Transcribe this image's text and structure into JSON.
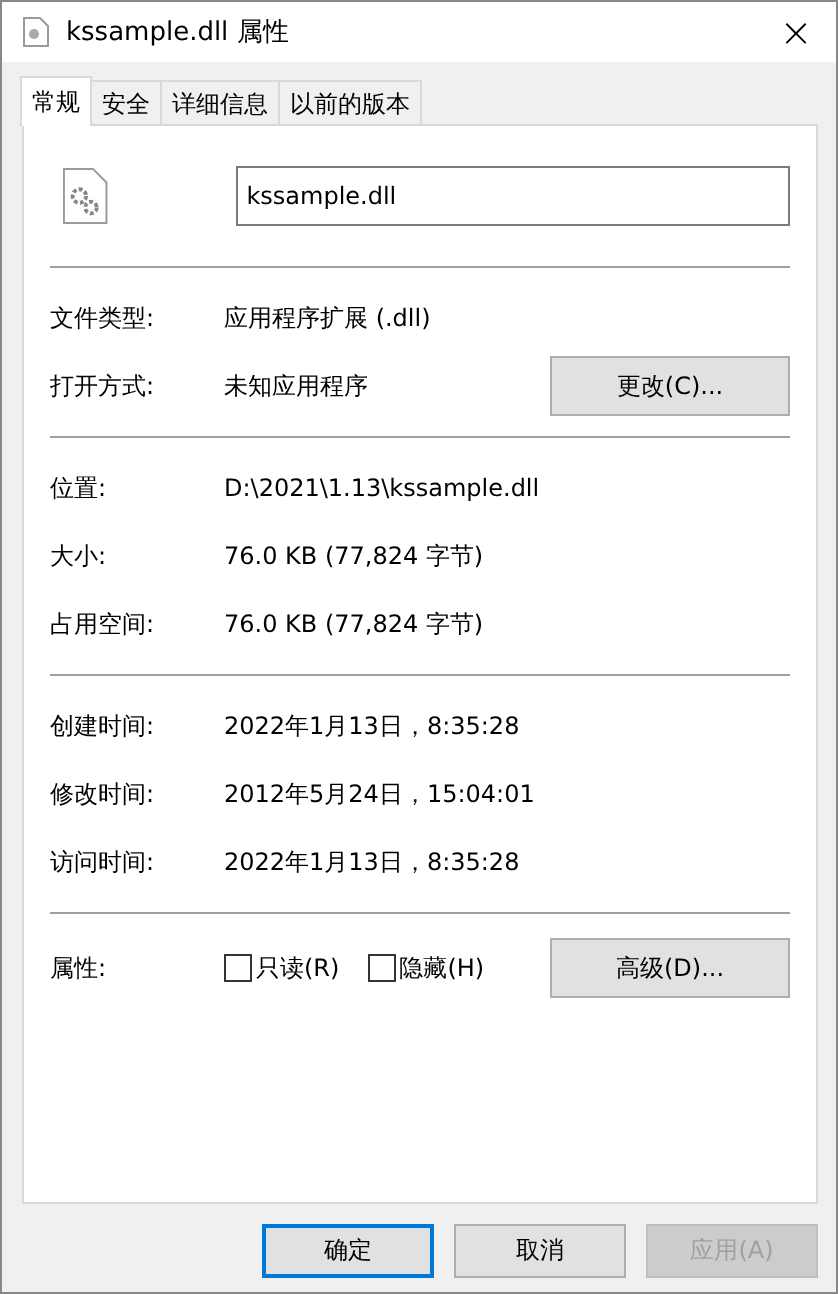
{
  "window": {
    "title": "kssample.dll 属性",
    "close": "×"
  },
  "tabs": [
    {
      "label": "常规",
      "selected": true
    },
    {
      "label": "安全",
      "selected": false
    },
    {
      "label": "详细信息",
      "selected": false
    },
    {
      "label": "以前的版本",
      "selected": false
    }
  ],
  "file_name": {
    "value": "kssample.dll"
  },
  "sections": [
    {
      "rows": [
        {
          "label": "文件类型:",
          "value": "应用程序扩展 (.dll)"
        },
        {
          "label": "打开方式:",
          "value": "未知应用程序",
          "button": "更改(C)..."
        }
      ]
    },
    {
      "rows": [
        {
          "label": "位置:",
          "value": "D:\\2021\\1.13\\kssample.dll"
        },
        {
          "label": "大小:",
          "value": "76.0 KB (77,824 字节)"
        },
        {
          "label": "占用空间:",
          "value": "76.0 KB (77,824 字节)"
        }
      ]
    },
    {
      "rows": [
        {
          "label": "创建时间:",
          "value": "2022年1月13日，8:35:28"
        },
        {
          "label": "修改时间:",
          "value": "2012年5月24日，15:04:01"
        },
        {
          "label": "访问时间:",
          "value": "2022年1月13日，8:35:28"
        }
      ]
    }
  ],
  "attributes": {
    "label": "属性:",
    "checkboxes": [
      {
        "label": "只读(R)",
        "checked": false
      },
      {
        "label": "隐藏(H)",
        "checked": false
      }
    ],
    "button": "高级(D)..."
  },
  "buttons": [
    {
      "label": "确定",
      "kind": "default"
    },
    {
      "label": "取消",
      "kind": "normal"
    },
    {
      "label": "应用(A)",
      "kind": "disabled"
    }
  ]
}
